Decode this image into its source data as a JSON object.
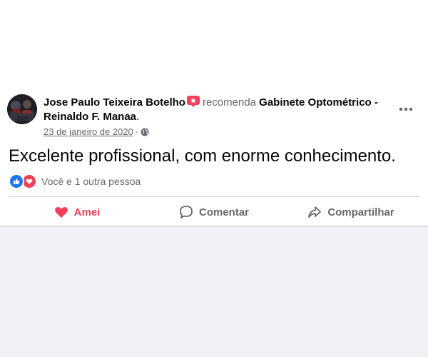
{
  "post": {
    "author": "Jose Paulo Teixeira Botelho",
    "verb": "recomenda",
    "page_name": "Gabinete Optométrico - Reinaldo F. Manaa",
    "period": ".",
    "date": "23 de janeiro de 2020",
    "separator": "·",
    "privacy_icon": "globe-icon",
    "text": "Excelente profissional, com enorme conhecimento."
  },
  "reactions": {
    "icons": [
      "like-icon",
      "love-icon"
    ],
    "summary": "Você e 1 outra pessoa"
  },
  "actions": {
    "love_label": "Amei",
    "comment_label": "Comentar",
    "share_label": "Compartilhar"
  },
  "colors": {
    "like": "#1877f2",
    "love": "#f33e58",
    "secondary_text": "#65676b",
    "recommend_badge": "#f3425f"
  }
}
